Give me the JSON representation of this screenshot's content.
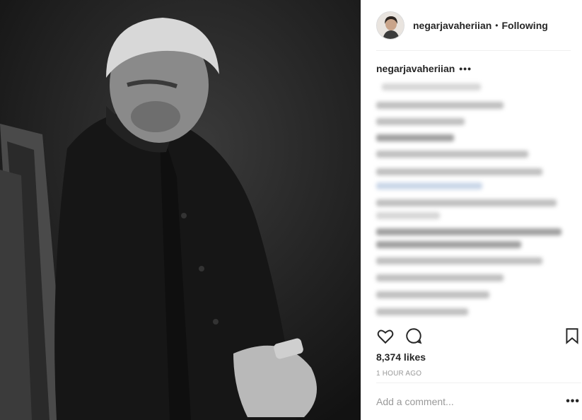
{
  "post": {
    "image_alt": "Black and white photograph of an elderly man seated on a chair"
  },
  "header": {
    "username": "negarjavaheriian",
    "separator": "•",
    "follow_status": "Following"
  },
  "caption": {
    "username": "negarjavaheriian",
    "more": "•••"
  },
  "stats": {
    "likes": "8,374 likes",
    "time": "1 HOUR AGO"
  },
  "comment_box": {
    "placeholder": "Add a comment...",
    "more": "•••"
  },
  "icons": {
    "like": "heart-icon",
    "comment": "comment-icon",
    "save": "bookmark-icon"
  }
}
